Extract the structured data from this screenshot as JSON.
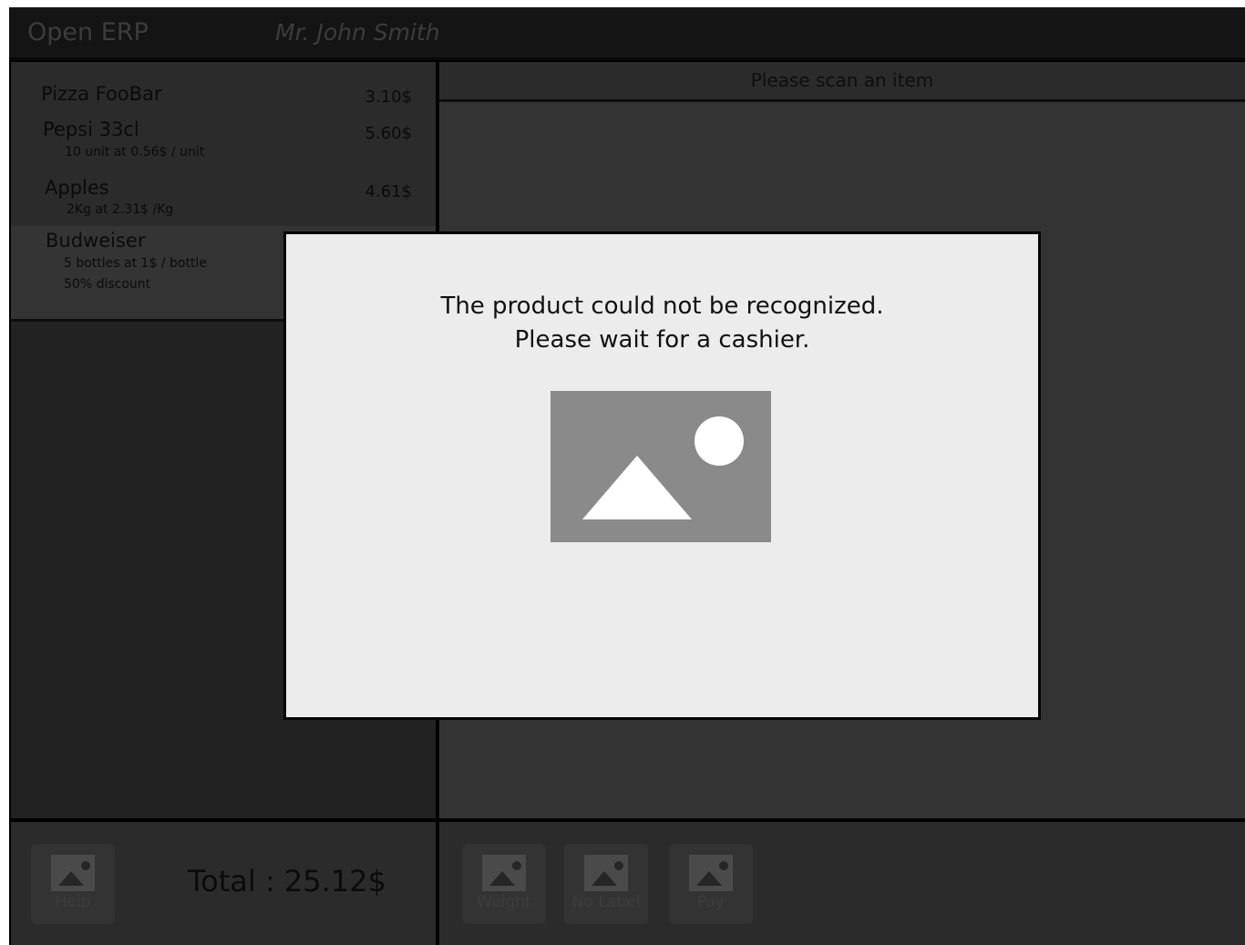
{
  "header": {
    "app_title": "Open ERP",
    "user_name": "Mr. John Smith"
  },
  "receipt": {
    "items": [
      {
        "name": "Pizza FooBar",
        "price": "3.10$",
        "details": []
      },
      {
        "name": "Pepsi 33cl",
        "price": "5.60$",
        "details": [
          "10 unit at 0.56$ / unit"
        ]
      },
      {
        "name": "Apples",
        "price": "4.61$",
        "details": [
          "2Kg at 2.31$ /Kg"
        ]
      },
      {
        "name": "Budweiser",
        "price": "",
        "details": [
          "5 bottles at 1$ / bottle",
          "50% discount"
        ]
      }
    ]
  },
  "scan": {
    "message": "Please scan an item"
  },
  "footer": {
    "help_label": "Help",
    "total_label": "Total : 25.12$",
    "actions": [
      {
        "label": "Weight"
      },
      {
        "label": "No Label"
      },
      {
        "label": "Pay"
      }
    ]
  },
  "dialog": {
    "line1": "The product could not be recognized.",
    "line2": "Please wait for a cashier."
  },
  "colors": {
    "background": "#000000",
    "panel": "#2b2b2b",
    "dialog": "#ececec",
    "placeholder": "#8a8a8a"
  }
}
